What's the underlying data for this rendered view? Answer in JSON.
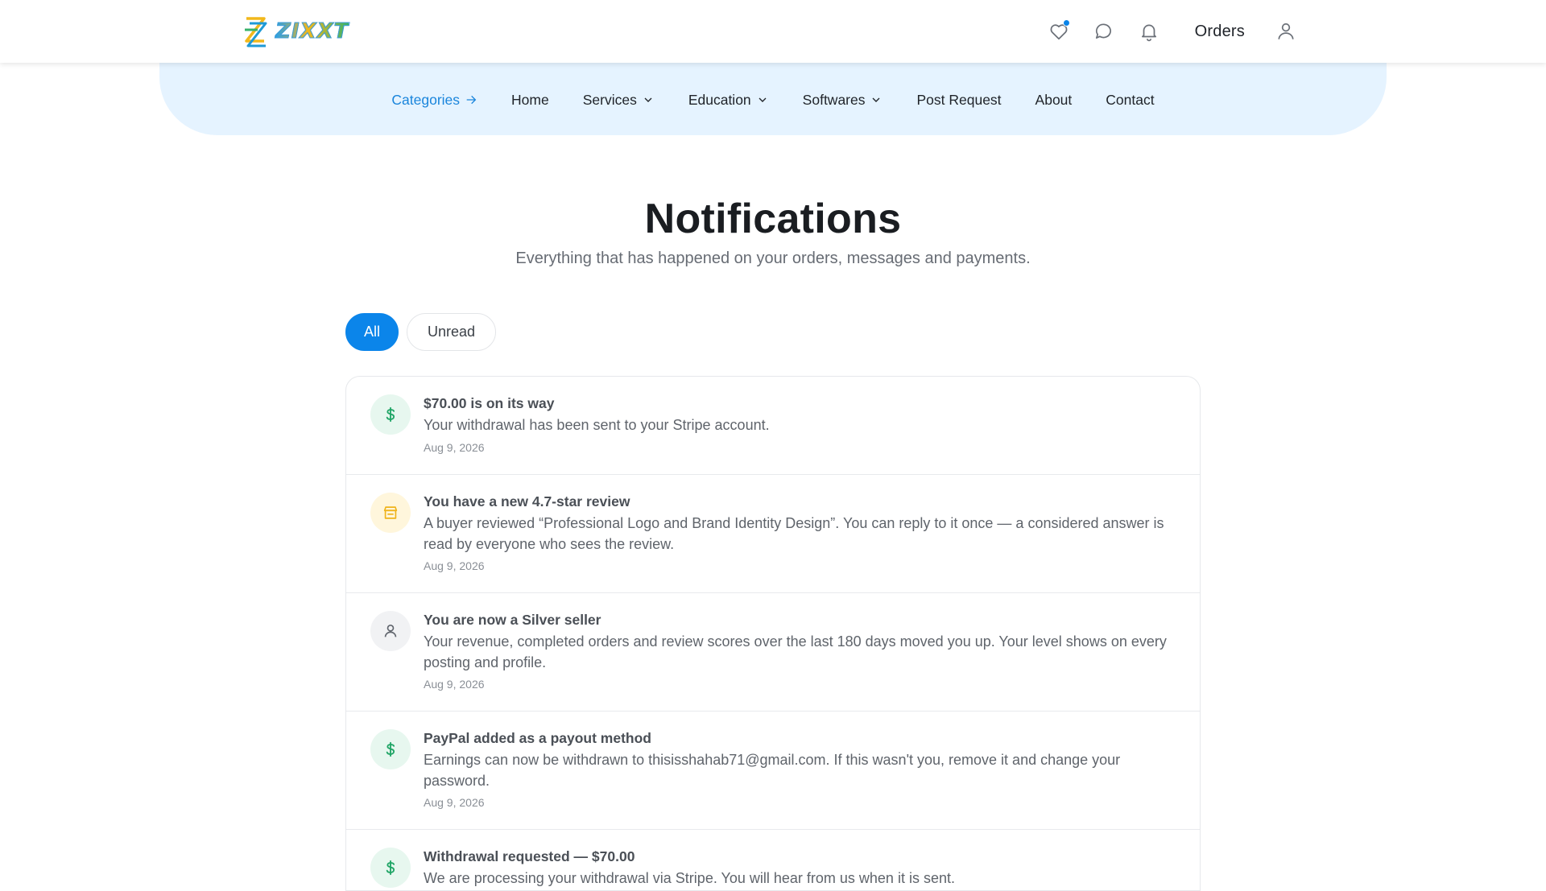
{
  "brand": {
    "logo_text": "ZIXXT"
  },
  "header": {
    "orders_label": "Orders",
    "icons": [
      "heart-icon",
      "chat-icon",
      "bell-icon",
      "user-icon"
    ]
  },
  "nav": {
    "categories": "Categories",
    "home": "Home",
    "services": "Services",
    "education": "Education",
    "softwares": "Softwares",
    "post_request": "Post Request",
    "about": "About",
    "contact": "Contact"
  },
  "page": {
    "title": "Notifications",
    "subtitle": "Everything that has happened on your orders, messages and payments."
  },
  "filters": {
    "all": "All",
    "unread": "Unread",
    "selected": "All"
  },
  "notifications": [
    {
      "icon": "dollar-icon",
      "title": "$70.00 is on its way",
      "body": "Your withdrawal has been sent to your Stripe account.",
      "date": "Aug 9, 2026"
    },
    {
      "icon": "storefront-icon",
      "title": "You have a new 4.7-star review",
      "body": "A buyer reviewed “Professional Logo and Brand Identity Design”. You can reply to it once — a considered answer is read by everyone who sees the review.",
      "date": "Aug 9, 2026"
    },
    {
      "icon": "user-icon",
      "title": "You are now a Silver seller",
      "body": "Your revenue, completed orders and review scores over the last 180 days moved you up. Your level shows on every posting and profile.",
      "date": "Aug 9, 2026"
    },
    {
      "icon": "dollar-icon",
      "title": "PayPal added as a payout method",
      "body": "Earnings can now be withdrawn to thisisshahab71@gmail.com. If this wasn't you, remove it and change your password.",
      "date": "Aug 9, 2026"
    },
    {
      "icon": "dollar-icon",
      "title": "Withdrawal requested — $70.00",
      "body": "We are processing your withdrawal via Stripe. You will hear from us when it is sent.",
      "date": ""
    }
  ],
  "colors": {
    "accent": "#0b85ea",
    "nav_bg": "#e5f3ff",
    "money_bg": "#e7f7ef",
    "star_bg": "#fff6dc"
  }
}
